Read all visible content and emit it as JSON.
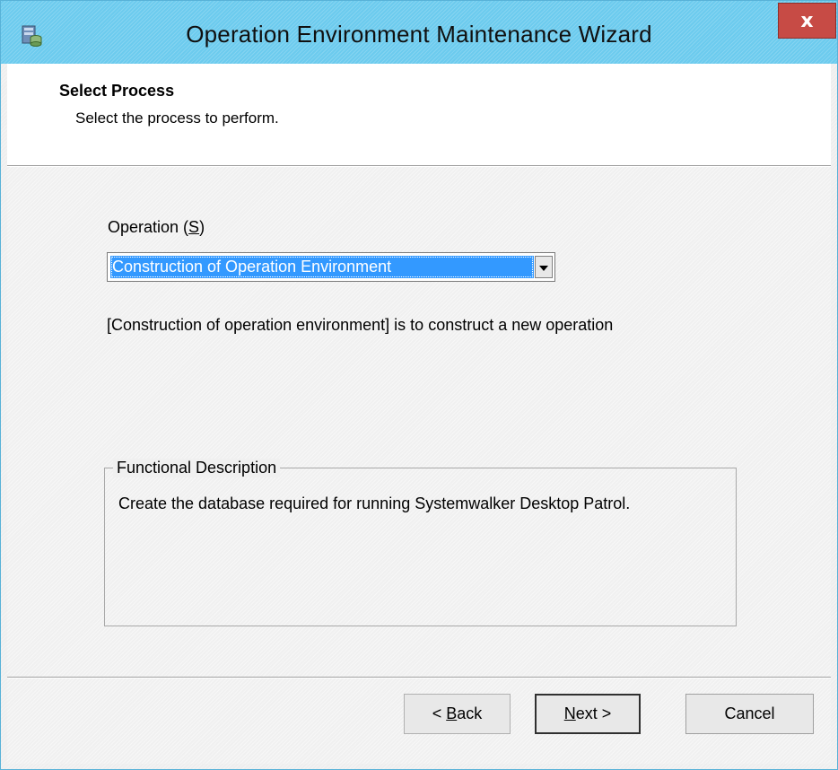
{
  "window": {
    "title": "Operation Environment Maintenance Wizard",
    "close_label": "x"
  },
  "header": {
    "title": "Select Process",
    "subtitle": "Select the process to perform."
  },
  "operation": {
    "label_text": "Operation (",
    "label_accel": "S",
    "label_end": ")",
    "selected_value": "Construction of Operation Environment",
    "description": "[Construction of operation environment] is to construct a new operation"
  },
  "functional": {
    "legend": "Functional Description",
    "text": "Create the database required for running Systemwalker Desktop Patrol."
  },
  "buttons": {
    "back_prefix": "< ",
    "back_accel": "B",
    "back_rest": "ack",
    "next_accel": "N",
    "next_rest": "ext >",
    "cancel": "Cancel"
  },
  "icons": {
    "app": "database-server-icon",
    "close": "close-icon",
    "dropdown": "chevron-down-icon"
  },
  "colors": {
    "titlebar": "#6ccbee",
    "close": "#c74b45",
    "selection": "#3399ff"
  }
}
